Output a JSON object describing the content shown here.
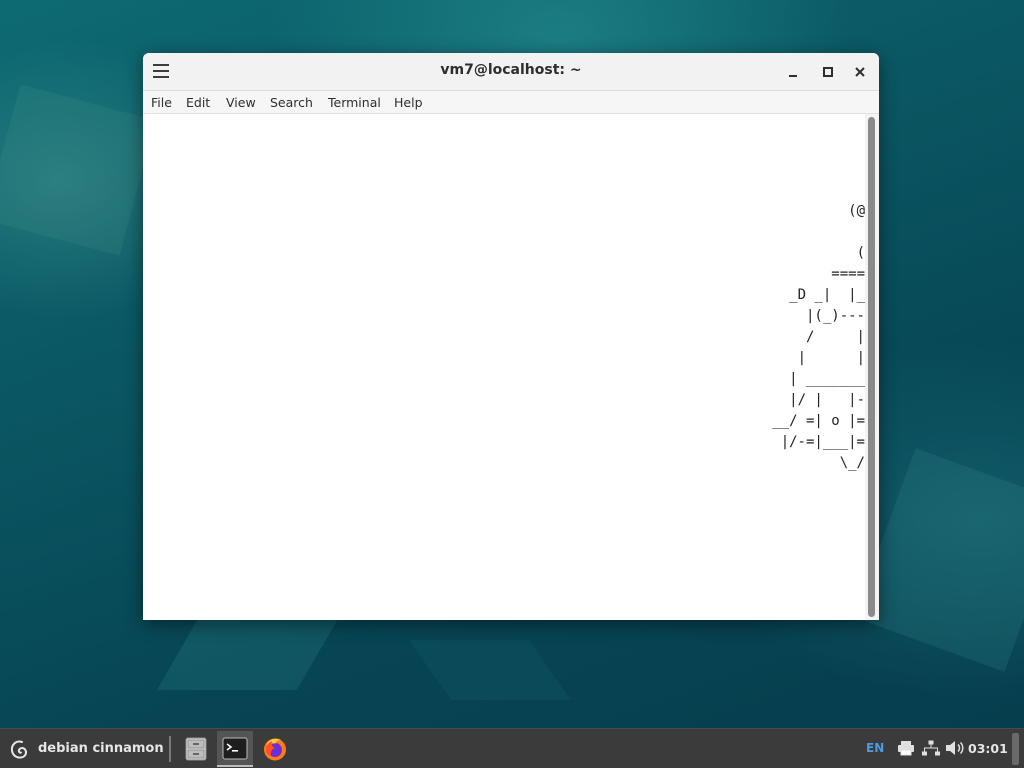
{
  "window": {
    "title": "vm7@localhost: ~",
    "menu": [
      "File",
      "Edit",
      "View",
      "Search",
      "Terminal",
      "Help"
    ]
  },
  "terminal": {
    "output": "(@\n\n(\n====\n_D _|  |_\n|(_)---\n/     |\n|      |\n| _______\n|/ |   |-\n__/ =| o |=\n|/-=|___|=\n\\_/"
  },
  "taskbar": {
    "menu_label": "debian cinnamon",
    "launchers": [
      "file-manager-icon",
      "terminal-icon",
      "firefox-icon"
    ],
    "keyboard_layout": "EN",
    "clock": "03:01"
  },
  "colors": {
    "accent_blue": "#4d9be0",
    "taskbar": "#3b3b3b",
    "wallpaper": "#0a5561"
  }
}
